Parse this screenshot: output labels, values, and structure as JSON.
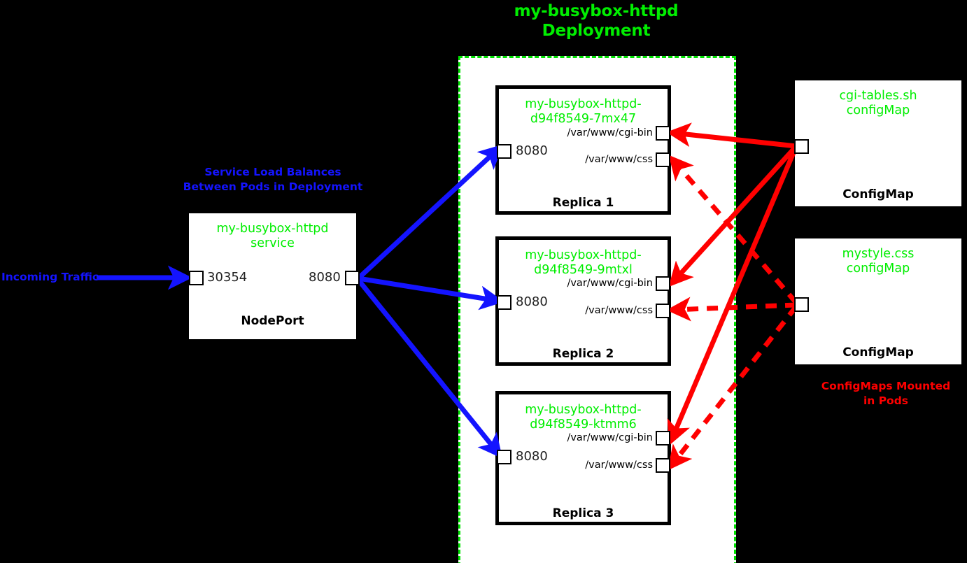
{
  "diagram": {
    "title": "my-busybox-httpd\nDeployment",
    "background_color": "#000000",
    "deployment_border_color": "#00e000",
    "accent_green": "#00ee00",
    "accent_blue": "#1414ff",
    "accent_red": "#ff0000"
  },
  "incoming": {
    "label": "Incoming Traffic"
  },
  "service": {
    "caption": "Service Load Balances\nBetween Pods in Deployment",
    "name": "my-busybox-httpd\nservice",
    "type_label": "NodePort",
    "node_port": "30354",
    "target_port": "8080"
  },
  "replicas": [
    {
      "name": "my-busybox-httpd-\nd94f8549-7mx47",
      "footer": "Replica 1",
      "port": "8080",
      "mounts": [
        "/var/www/cgi-bin",
        "/var/www/css"
      ]
    },
    {
      "name": "my-busybox-httpd-\nd94f8549-9mtxl",
      "footer": "Replica 2",
      "port": "8080",
      "mounts": [
        "/var/www/cgi-bin",
        "/var/www/css"
      ]
    },
    {
      "name": "my-busybox-httpd-\nd94f8549-ktmm6",
      "footer": "Replica 3",
      "port": "8080",
      "mounts": [
        "/var/www/cgi-bin",
        "/var/www/css"
      ]
    }
  ],
  "configmaps": [
    {
      "name": "cgi-tables.sh\nconfigMap",
      "footer": "ConfigMap",
      "line_style": "solid"
    },
    {
      "name": "mystyle.css\nconfigMap",
      "footer": "ConfigMap",
      "line_style": "dashed"
    }
  ],
  "configmap_caption": "ConfigMaps Mounted\nin Pods"
}
